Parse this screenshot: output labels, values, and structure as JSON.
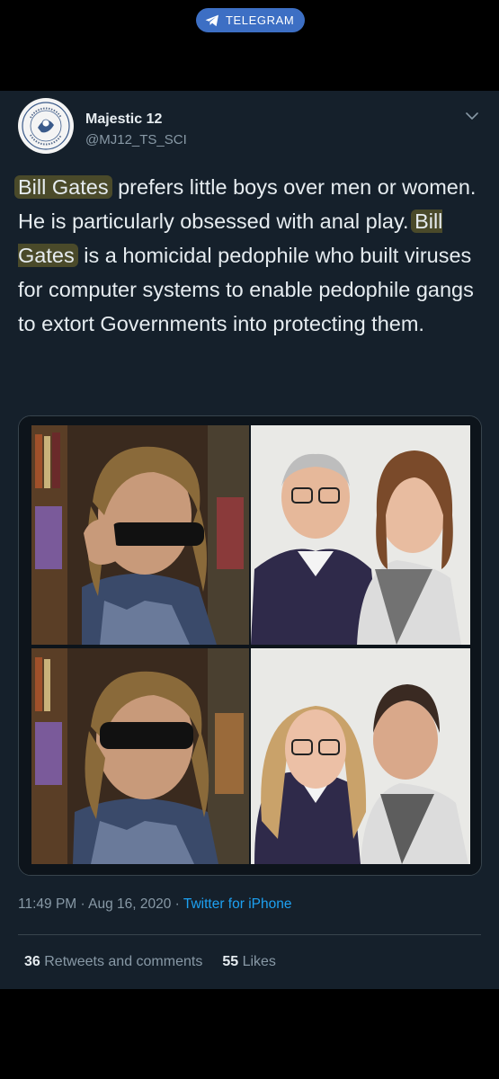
{
  "banner": {
    "label": "TELEGRAM",
    "color": "#3d6fc4"
  },
  "tweet": {
    "author_name": "Majestic 12",
    "author_handle": "@MJ12_TS_SCI",
    "text": {
      "hl1": "Bill Gates",
      "seg1": " prefers little boys over men or women. He is particularly obsessed with anal play. ",
      "hl2": "Bill Gates",
      "seg2": " is a homicidal pedophile who built viruses for computer systems to enable pedophile gangs to extort Governments into protecting them."
    },
    "time": "11:49 PM",
    "sep1": " · ",
    "date": "Aug 16, 2020",
    "sep2": " · ",
    "client": "Twitter for iPhone",
    "retweets_count": "36",
    "retweets_label": "Retweets and comments",
    "likes_count": "55",
    "likes_label": "Likes"
  },
  "media": {
    "description_icon": "photo-collage"
  },
  "colors": {
    "card_bg": "#15202b",
    "text": "#e6ecf0",
    "muted": "#8899a6",
    "link": "#1da1f2",
    "highlight": "#4a4a2a"
  }
}
